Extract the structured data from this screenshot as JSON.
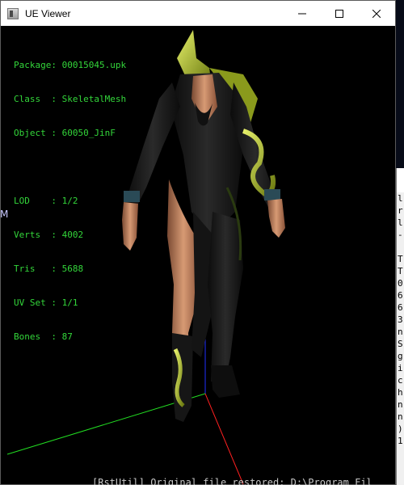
{
  "window": {
    "title": "UE Viewer",
    "minimize_icon": "minimize-icon",
    "maximize_icon": "maximize-icon",
    "close_icon": "close-icon"
  },
  "info": {
    "package": "Package: 00015045.upk",
    "class": "Class  : SkeletalMesh",
    "object": "Object : 60050_JinF",
    "lod": "LOD    : 1/2",
    "verts": "Verts  : 4002",
    "tris": "Tris   : 5688",
    "uvset": "UV Set : 1/1",
    "bones": "Bones  : 87"
  },
  "colors": {
    "info_text": "#33d63a",
    "axis_x": "#ff2020",
    "axis_y": "#22dd22",
    "axis_z": "#2030ff"
  },
  "console": {
    "lines": [
      "l",
      "r",
      "l",
      "-",
      "",
      "T",
      "T",
      "0",
      "6",
      "6",
      "3",
      "n",
      "S",
      "g",
      "i",
      "c",
      "h",
      "n",
      "n",
      ")",
      "1"
    ]
  },
  "status": {
    "line": "[RstUtil] Original file restored: D:\\Program Fil"
  },
  "desktop": {
    "left_glyph": "M"
  }
}
